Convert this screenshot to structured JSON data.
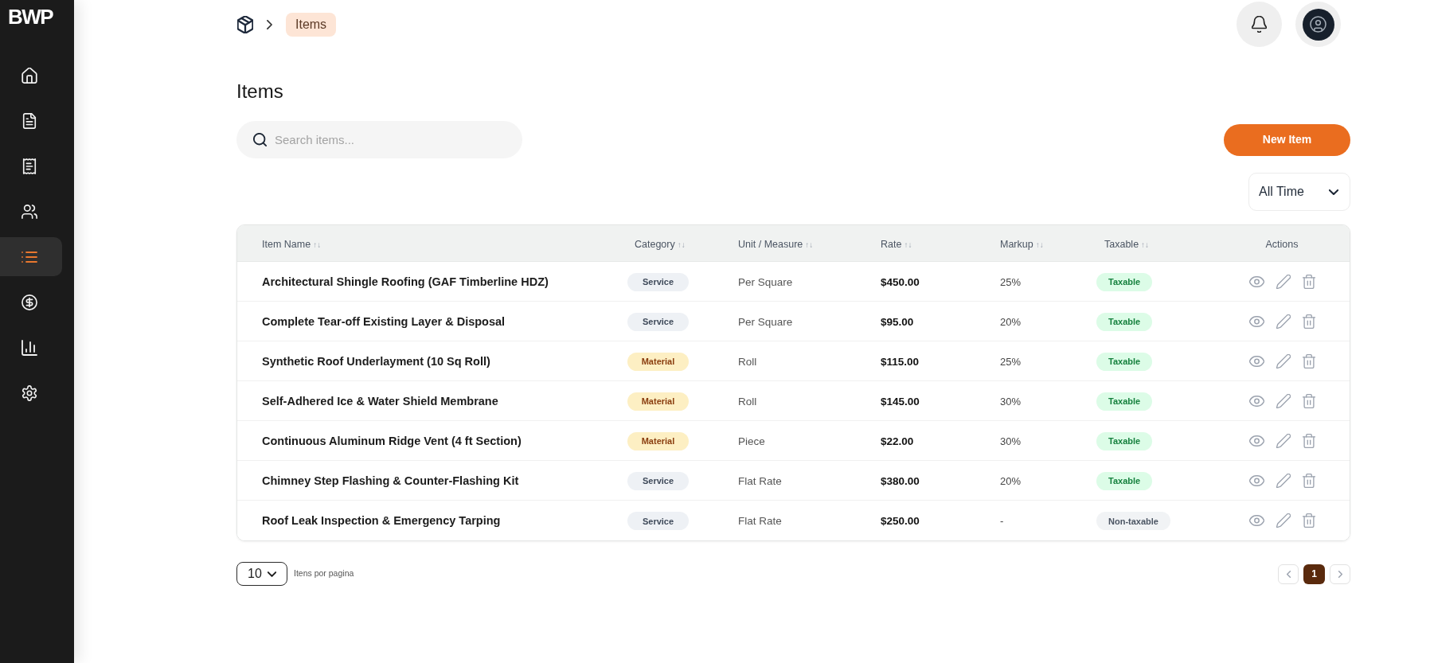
{
  "sidebar": {
    "logo": "BWP",
    "items": [
      {
        "selected": false
      },
      {
        "selected": false
      },
      {
        "selected": false
      },
      {
        "selected": false
      },
      {
        "selected": true
      },
      {
        "selected": false
      },
      {
        "selected": false
      },
      {
        "selected": false
      }
    ]
  },
  "breadcrumb": {
    "current": "Items"
  },
  "title": "Items",
  "search": {
    "placeholder": "Search items..."
  },
  "new_button": "New Item",
  "period_filter": {
    "value": "All Time"
  },
  "table": {
    "columns": [
      {
        "label": "Item Name",
        "sort": "↑↓"
      },
      {
        "label": "Category",
        "sort": "↑↓"
      },
      {
        "label": "Unit / Measure",
        "sort": "↑↓"
      },
      {
        "label": "Rate",
        "sort": "↑↓"
      },
      {
        "label": "Markup",
        "sort": "↑↓"
      },
      {
        "label": "Taxable",
        "sort": "↑↓"
      },
      {
        "label": "Actions"
      }
    ],
    "rows": [
      {
        "name": "Architectural Shingle Roofing (GAF Timberline HDZ)",
        "category": {
          "label": "Service",
          "kind": "service"
        },
        "unit": "Per Square",
        "rate": "$450.00",
        "markup": "25%",
        "taxable": {
          "label": "Taxable",
          "on": true
        }
      },
      {
        "name": "Complete Tear-off Existing Layer & Disposal",
        "category": {
          "label": "Service",
          "kind": "service"
        },
        "unit": "Per Square",
        "rate": "$95.00",
        "markup": "20%",
        "taxable": {
          "label": "Taxable",
          "on": true
        }
      },
      {
        "name": "Synthetic Roof Underlayment (10 Sq Roll)",
        "category": {
          "label": "Material",
          "kind": "material"
        },
        "unit": "Roll",
        "rate": "$115.00",
        "markup": "25%",
        "taxable": {
          "label": "Taxable",
          "on": true
        }
      },
      {
        "name": "Self-Adhered Ice & Water Shield Membrane",
        "category": {
          "label": "Material",
          "kind": "material"
        },
        "unit": "Roll",
        "rate": "$145.00",
        "markup": "30%",
        "taxable": {
          "label": "Taxable",
          "on": true
        }
      },
      {
        "name": "Continuous Aluminum Ridge Vent (4 ft Section)",
        "category": {
          "label": "Material",
          "kind": "material"
        },
        "unit": "Piece",
        "rate": "$22.00",
        "markup": "30%",
        "taxable": {
          "label": "Taxable",
          "on": true
        }
      },
      {
        "name": "Chimney Step Flashing & Counter-Flashing Kit",
        "category": {
          "label": "Service",
          "kind": "service"
        },
        "unit": "Flat Rate",
        "rate": "$380.00",
        "markup": "20%",
        "taxable": {
          "label": "Taxable",
          "on": true
        }
      },
      {
        "name": "Roof Leak Inspection & Emergency Tarping",
        "category": {
          "label": "Service",
          "kind": "service"
        },
        "unit": "Flat Rate",
        "rate": "$250.00",
        "markup": "-",
        "taxable": {
          "label": "Non-taxable",
          "on": false
        }
      }
    ]
  },
  "pagination": {
    "per_page": "10",
    "per_page_label": "Itens por pagina",
    "pages": [
      {
        "label": "1",
        "selected": true
      }
    ]
  }
}
